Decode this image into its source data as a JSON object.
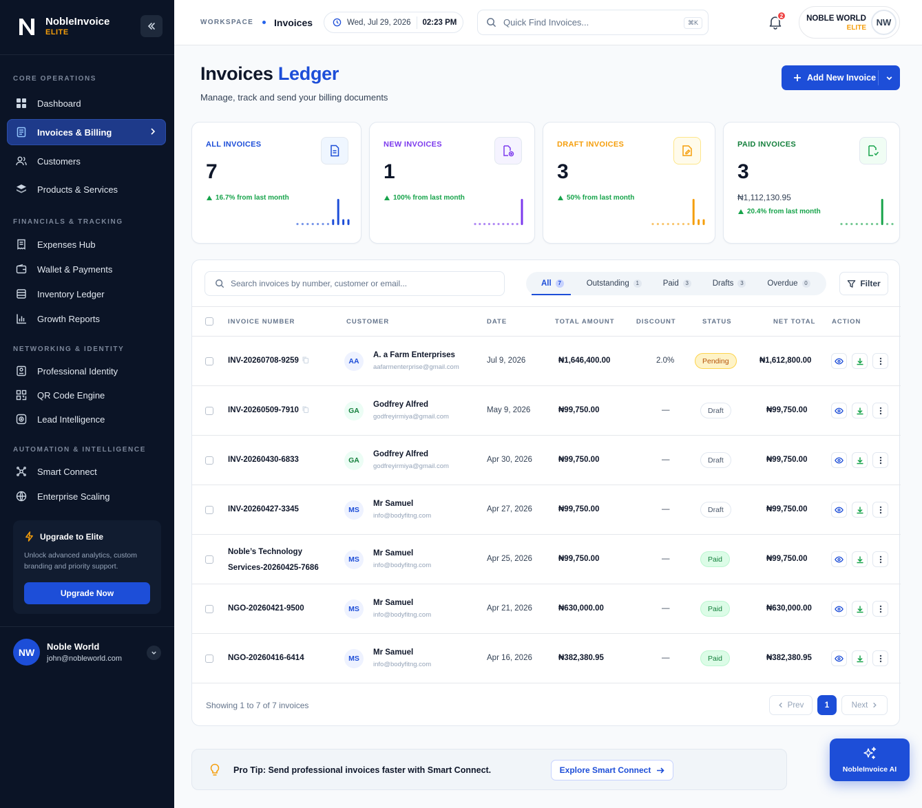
{
  "brand": {
    "name": "NobleInvoice",
    "tier": "ELITE"
  },
  "sidebar": {
    "sections": [
      {
        "title": "CORE OPERATIONS"
      },
      {
        "title": "FINANCIALS & TRACKING"
      },
      {
        "title": "NETWORKING & IDENTITY"
      },
      {
        "title": "AUTOMATION & INTELLIGENCE"
      }
    ],
    "items": [
      {
        "label": "Dashboard",
        "icon": "grid-icon"
      },
      {
        "label": "Invoices & Billing",
        "icon": "invoice-icon",
        "active": true
      },
      {
        "label": "Customers",
        "icon": "users-icon"
      },
      {
        "label": "Products & Services",
        "icon": "layers-icon"
      },
      {
        "label": "Expenses Hub",
        "icon": "receipt-icon"
      },
      {
        "label": "Wallet & Payments",
        "icon": "wallet-icon"
      },
      {
        "label": "Inventory Ledger",
        "icon": "ledger-icon"
      },
      {
        "label": "Growth Reports",
        "icon": "bar-chart-icon"
      },
      {
        "label": "Professional Identity",
        "icon": "id-card-icon"
      },
      {
        "label": "QR Code Engine",
        "icon": "qr-code-icon"
      },
      {
        "label": "Lead Intelligence",
        "icon": "target-icon"
      },
      {
        "label": "Smart Connect",
        "icon": "network-icon"
      },
      {
        "label": "Enterprise Scaling",
        "icon": "globe-icon"
      }
    ],
    "upgrade": {
      "title": "Upgrade to Elite",
      "description": "Unlock advanced analytics, custom branding and priority support.",
      "button": "Upgrade Now"
    },
    "user": {
      "initials": "NW",
      "name": "Noble World",
      "email": "john@nobleworld.com"
    }
  },
  "topbar": {
    "breadcrumb_root": "WORKSPACE",
    "breadcrumb_current": "Invoices",
    "date": "Wed, Jul 29, 2026",
    "time": "02:23 PM",
    "search_placeholder": "Quick Find Invoices...",
    "search_shortcut": "⌘K",
    "notification_count": "2",
    "user_name": "NOBLE WORLD",
    "user_tier": "ELITE",
    "user_initials": "NW"
  },
  "header": {
    "title_main": "Invoices",
    "title_accent": "Ledger",
    "subtitle": "Manage, track and send your billing documents",
    "add_button": "Add New Invoice"
  },
  "stats": [
    {
      "label": "ALL INVOICES",
      "value": "7",
      "amount": "",
      "trend": "16.7% from last month",
      "color": "#1d4ed8",
      "icon": "document-icon",
      "spark": [
        1,
        1,
        1,
        1,
        1,
        1,
        1,
        2,
        9,
        2,
        2
      ]
    },
    {
      "label": "NEW INVOICES",
      "value": "1",
      "amount": "",
      "trend": "100% from last month",
      "color": "#7c3aed",
      "icon": "file-plus-icon",
      "spark": [
        1,
        1,
        1,
        1,
        1,
        1,
        1,
        1,
        1,
        1,
        9
      ]
    },
    {
      "label": "DRAFT INVOICES",
      "value": "3",
      "amount": "",
      "trend": "50% from last month",
      "color": "#f59e0b",
      "icon": "draft-icon",
      "spark": [
        1,
        1,
        1,
        1,
        1,
        1,
        1,
        1,
        9,
        2,
        2
      ]
    },
    {
      "label": "PAID INVOICES",
      "value": "3",
      "amount": "₦1,112,130.95",
      "trend": "20.4% from last month",
      "color": "#16a34a",
      "icon": "file-check-icon",
      "spark": [
        1,
        1,
        1,
        1,
        1,
        1,
        1,
        1,
        9,
        1,
        1
      ]
    }
  ],
  "table": {
    "search_placeholder": "Search invoices by number, customer or email...",
    "tabs": [
      {
        "label": "All",
        "count": "7"
      },
      {
        "label": "Outstanding",
        "count": "1"
      },
      {
        "label": "Paid",
        "count": "3"
      },
      {
        "label": "Drafts",
        "count": "3"
      },
      {
        "label": "Overdue",
        "count": "0"
      }
    ],
    "filter_label": "Filter",
    "columns": [
      "INVOICE NUMBER",
      "CUSTOMER",
      "DATE",
      "TOTAL AMOUNT",
      "DISCOUNT",
      "STATUS",
      "NET TOTAL",
      "ACTION"
    ],
    "rows": [
      {
        "number": "INV-20260708-9259",
        "copy": true,
        "initials": "AA",
        "customer": "A. a Farm Enterprises",
        "email": "aafarmenterprise@gmail.com",
        "date": "Jul 9, 2026",
        "total": "₦1,646,400.00",
        "discount": "2.0%",
        "status": "Pending",
        "net": "₦1,612,800.00"
      },
      {
        "number": "INV-20260509-7910",
        "copy": true,
        "initials": "GA",
        "customer": "Godfrey Alfred",
        "email": "godfreyirmiya@gmail.com",
        "date": "May 9, 2026",
        "total": "₦99,750.00",
        "discount": "—",
        "status": "Draft",
        "net": "₦99,750.00"
      },
      {
        "number": "INV-20260430-6833",
        "copy": false,
        "initials": "GA",
        "customer": "Godfrey Alfred",
        "email": "godfreyirmiya@gmail.com",
        "date": "Apr 30, 2026",
        "total": "₦99,750.00",
        "discount": "—",
        "status": "Draft",
        "net": "₦99,750.00"
      },
      {
        "number": "INV-20260427-3345",
        "copy": false,
        "initials": "MS",
        "customer": "Mr Samuel",
        "email": "info@bodyfitng.com",
        "date": "Apr 27, 2026",
        "total": "₦99,750.00",
        "discount": "—",
        "status": "Draft",
        "net": "₦99,750.00"
      },
      {
        "number": "Noble’s Technology Services-20260425-7686",
        "copy": false,
        "initials": "MS",
        "customer": "Mr Samuel",
        "email": "info@bodyfitng.com",
        "date": "Apr 25, 2026",
        "total": "₦99,750.00",
        "discount": "—",
        "status": "Paid",
        "net": "₦99,750.00"
      },
      {
        "number": "NGO-20260421-9500",
        "copy": false,
        "initials": "MS",
        "customer": "Mr Samuel",
        "email": "info@bodyfitng.com",
        "date": "Apr 21, 2026",
        "total": "₦630,000.00",
        "discount": "—",
        "status": "Paid",
        "net": "₦630,000.00"
      },
      {
        "number": "NGO-20260416-6414",
        "copy": false,
        "initials": "MS",
        "customer": "Mr Samuel",
        "email": "info@bodyfitng.com",
        "date": "Apr 16, 2026",
        "total": "₦382,380.95",
        "discount": "—",
        "status": "Paid",
        "net": "₦382,380.95"
      }
    ],
    "footer_text": "Showing 1 to 7 of 7 invoices",
    "prev": "Prev",
    "page": "1",
    "next": "Next"
  },
  "tip": {
    "text": "Pro Tip: Send professional invoices faster with Smart Connect.",
    "button": "Explore Smart Connect"
  },
  "ai_button": "NobleInvoice AI"
}
